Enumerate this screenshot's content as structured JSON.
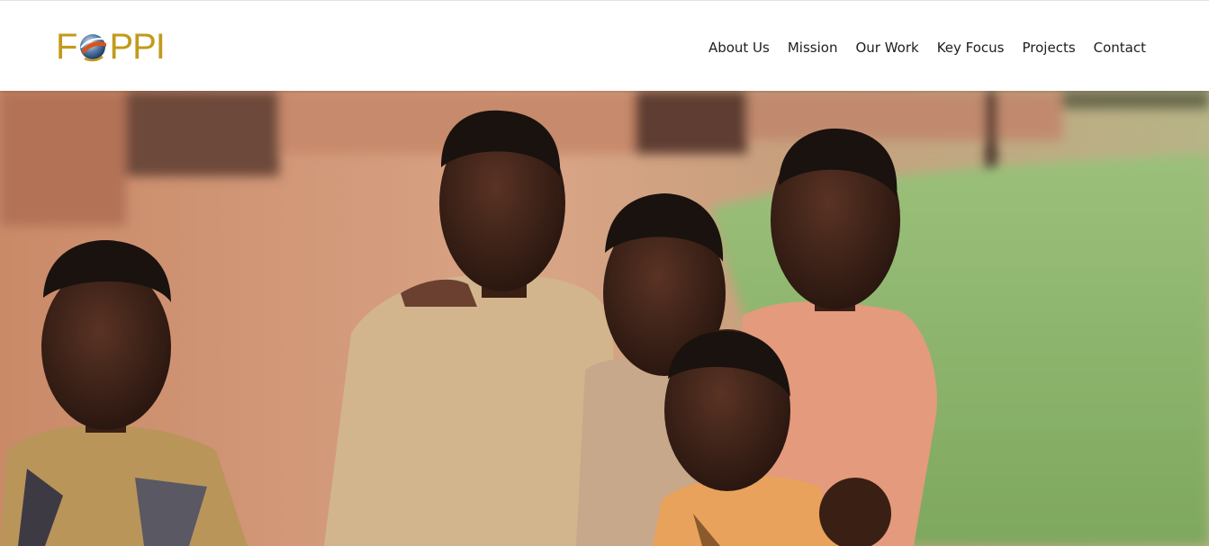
{
  "header": {
    "logo": {
      "text_left": "F",
      "text_right": "PPI",
      "alt": "FOPPI"
    },
    "nav": [
      {
        "label": "About Us"
      },
      {
        "label": "Mission"
      },
      {
        "label": "Our Work"
      },
      {
        "label": "Key Focus"
      },
      {
        "label": "Projects"
      },
      {
        "label": "Contact"
      }
    ]
  },
  "hero": {
    "image_subject": "five-smiling-children-photo"
  },
  "colors": {
    "brand_gold": "#c29a1c",
    "nav_text": "#1e1e1e",
    "header_bg": "#ffffff"
  }
}
